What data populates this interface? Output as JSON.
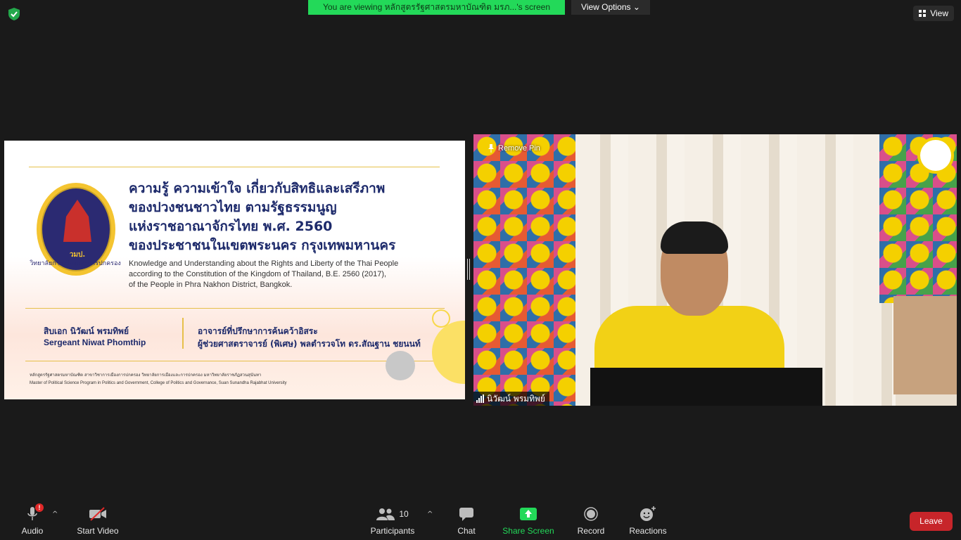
{
  "top_bar": {
    "viewing_banner": "You are viewing หลักสูตรรัฐศาสตรมหาบัณฑิต มรภ...'s screen",
    "view_options_label": "View Options",
    "view_label": "View"
  },
  "slide": {
    "title_th": [
      "ความรู้ ความเข้าใจ เกี่ยวกับสิทธิและเสรีภาพ",
      "ของปวงชนชาวไทย ตามรัฐธรรมนูญ",
      "แห่งราชอาณาจักรไทย พ.ศ. 2560",
      "ของประชาชนในเขตพระนคร กรุงเทพมหานคร"
    ],
    "title_en": [
      "Knowledge and Understanding about the Rights and Liberty of the Thai People",
      "according to the Constitution of the Kingdom of Thailand, B.E. 2560 (2017),",
      "of the People in Phra Nakhon District, Bangkok."
    ],
    "emblem_text": "วมป.",
    "emblem_ring": "วิทยาลัยการเมืองและการปกครอง",
    "presenter_th": "สิบเอก นิวัฒน์  พรมทิพย์",
    "presenter_en": "Sergeant Niwat Phomthip",
    "advisor_role": "อาจารย์ที่ปรึกษาการค้นคว้าอิสระ",
    "advisor_name": "ผู้ช่วยศาสตราจารย์ (พิเศษ) พลตำรวจโท ดร.สัณฐาน ชยนนท์",
    "footer_th": "หลักสูตรรัฐศาสตรมหาบัณฑิต สาขาวิชาการเมืองการปกครอง วิทยาลัยการเมืองและการปกครอง มหาวิทยาลัยราชภัฏสวนสุนันทา",
    "footer_en": "Master of Political Science Program in Politics and Government, College of Politics and Governance, Suan Sunandha Rajabhat University"
  },
  "video": {
    "remove_pin_label": "Remove Pin",
    "participant_name": "นิวัฒน์ พรมทิพย์"
  },
  "toolbar": {
    "audio_label": "Audio",
    "audio_badge": "!",
    "start_video_label": "Start Video",
    "participants_label": "Participants",
    "participants_count": "10",
    "chat_label": "Chat",
    "share_screen_label": "Share Screen",
    "record_label": "Record",
    "reactions_label": "Reactions",
    "leave_label": "Leave"
  },
  "colors": {
    "banner_green": "#23d959",
    "leave_red": "#c7252a",
    "background": "#1a1a1a",
    "slide_title_navy": "#1d2a6b"
  },
  "icons": {
    "security": "shield-check-icon",
    "view": "grid-icon",
    "audio": "microphone-icon",
    "video": "video-off-icon",
    "participants": "people-icon",
    "chat": "chat-bubble-icon",
    "share": "share-up-arrow-icon",
    "record": "record-circle-icon",
    "reactions": "smiley-plus-icon",
    "pin": "pin-icon",
    "signal": "signal-bars-icon"
  }
}
